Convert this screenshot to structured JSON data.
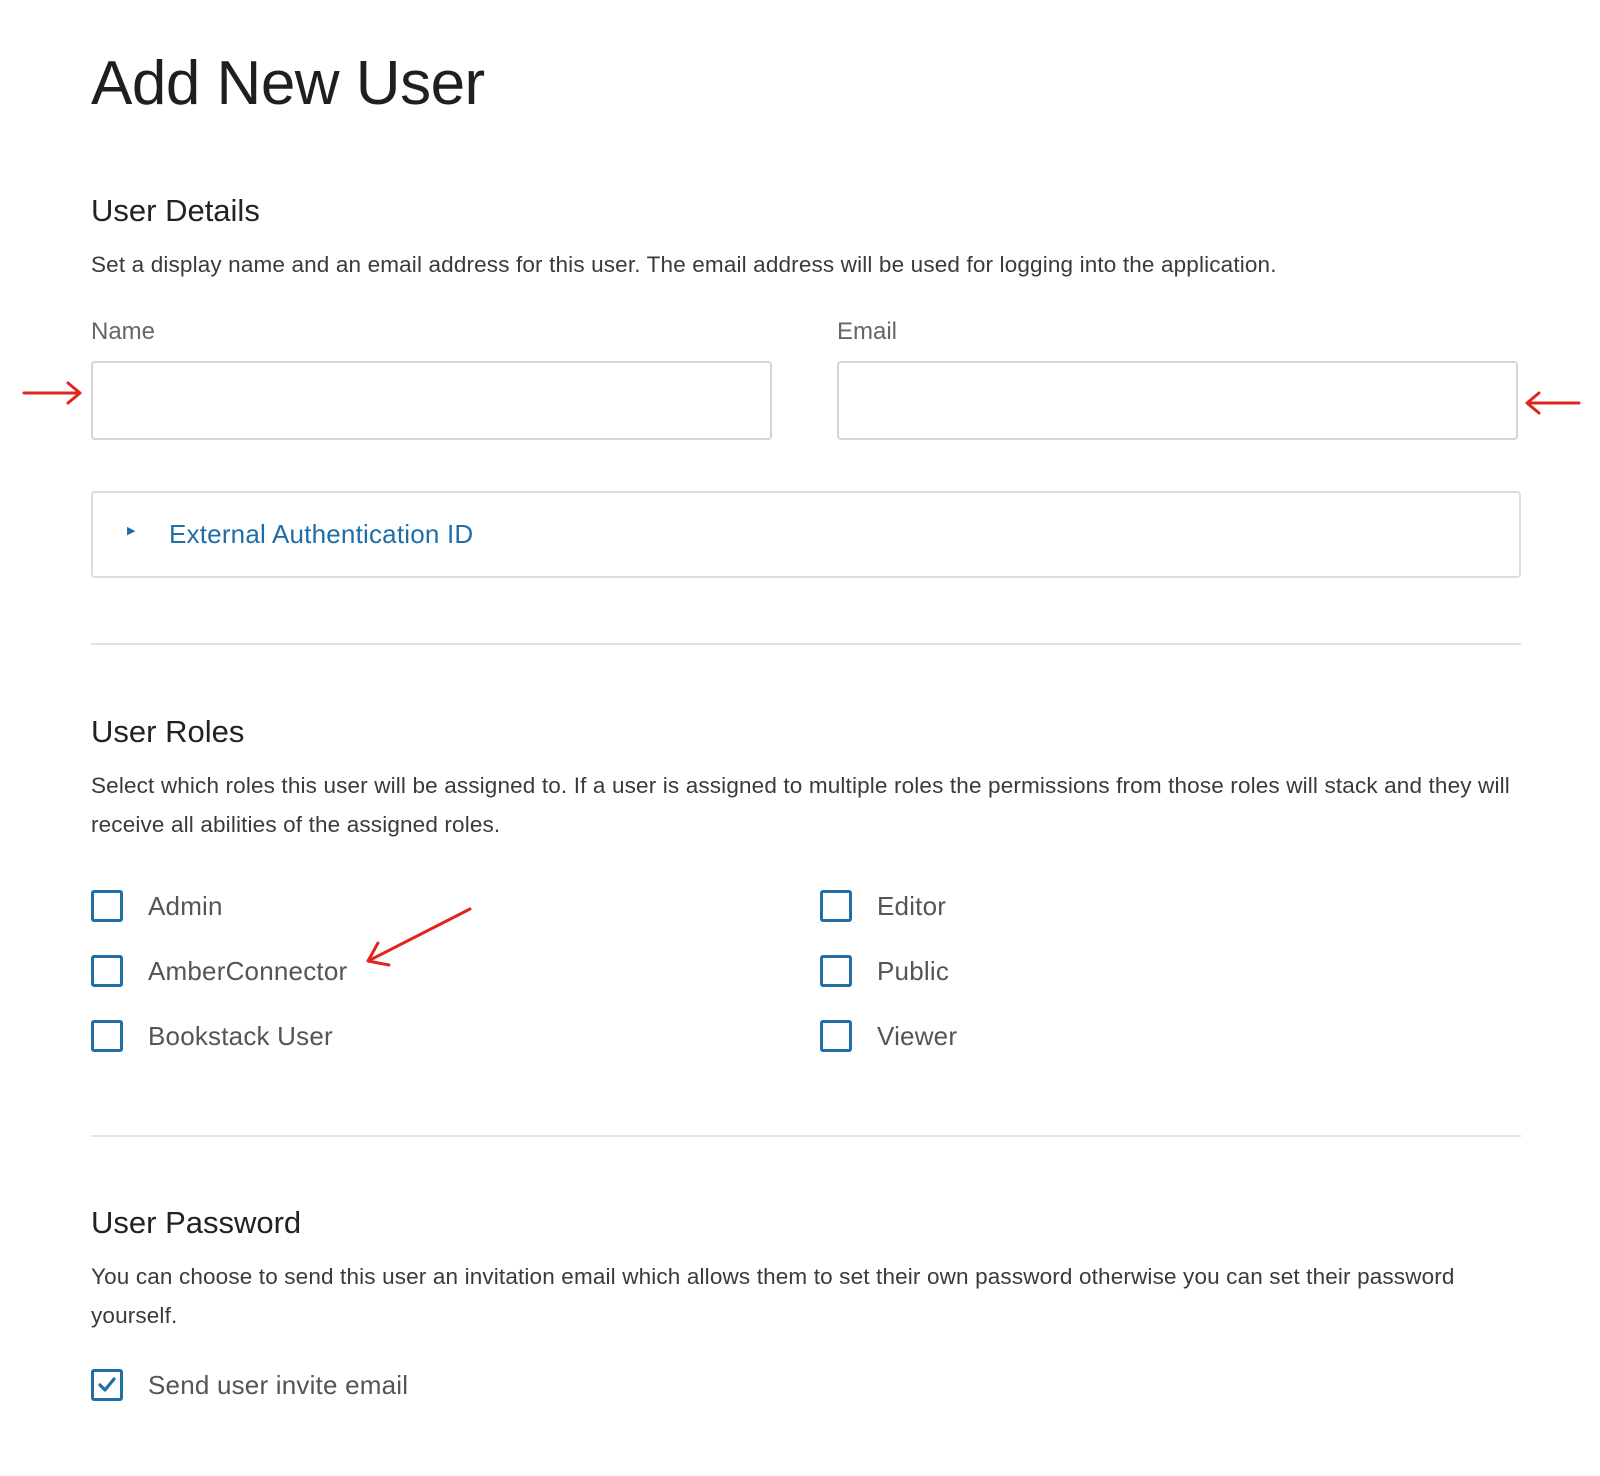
{
  "page": {
    "title": "Add New User"
  },
  "user_details": {
    "title": "User Details",
    "description": "Set a display name and an email address for this user. The email address will be used for logging into the application.",
    "name_label": "Name",
    "name_value": "",
    "email_label": "Email",
    "email_value": "",
    "external_auth_label": "External Authentication ID",
    "external_auth_expanded": false,
    "caret_icon": "caret-right-icon"
  },
  "user_roles": {
    "title": "User Roles",
    "description": "Select which roles this user will be assigned to. If a user is assigned to multiple roles the permissions from those roles will stack and they will receive all abilities of the assigned roles.",
    "roles": [
      {
        "label": "Admin",
        "checked": false
      },
      {
        "label": "AmberConnector",
        "checked": false
      },
      {
        "label": "Bookstack User",
        "checked": false
      },
      {
        "label": "Editor",
        "checked": false
      },
      {
        "label": "Public",
        "checked": false
      },
      {
        "label": "Viewer",
        "checked": false
      }
    ]
  },
  "user_password": {
    "title": "User Password",
    "description": "You can choose to send this user an invitation email which allows them to set their own password otherwise you can set their password yourself.",
    "invite_label": "Send user invite email",
    "invite_checked": true
  },
  "annotations": {
    "color": "#e0261c",
    "arrows": [
      "arrow-right-icon",
      "arrow-left-icon",
      "arrow-diagonal-icon"
    ]
  },
  "colors": {
    "accent": "#206ea7",
    "border": "#d4d4d4",
    "divider": "#e3e3e3"
  }
}
